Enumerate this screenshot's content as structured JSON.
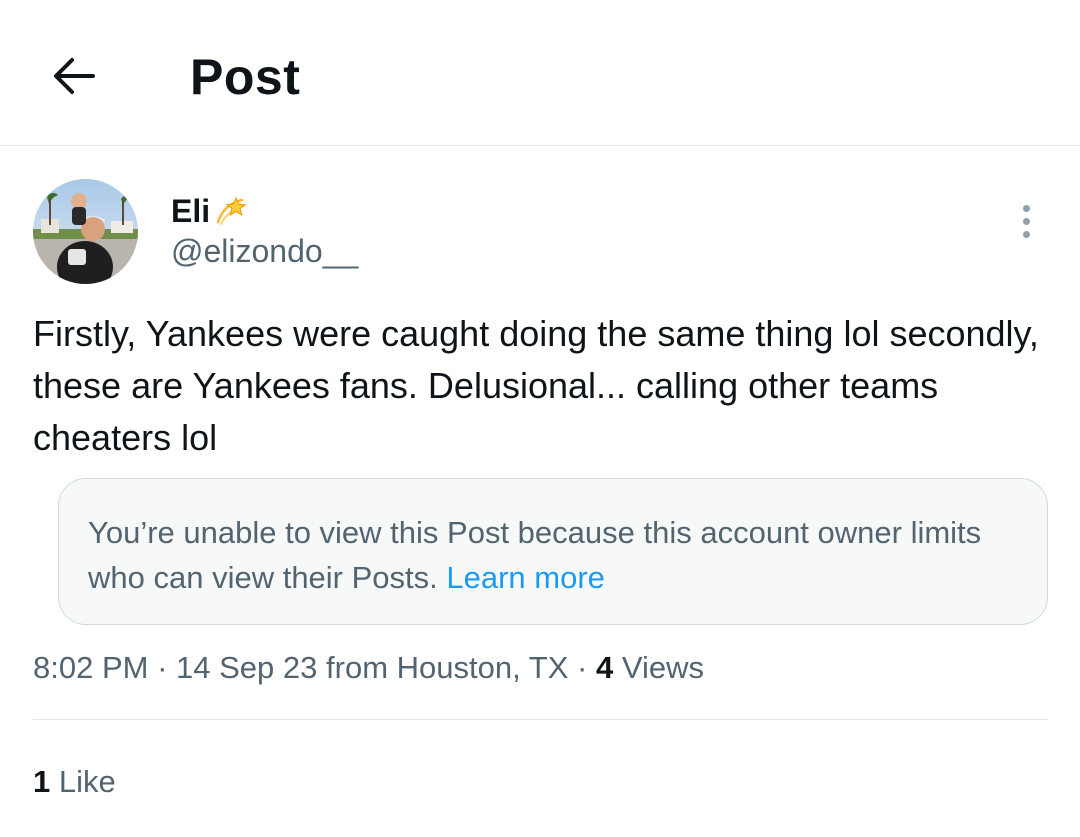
{
  "header": {
    "back_icon": "arrow-left-icon",
    "title": "Post"
  },
  "author": {
    "avatar_icon": "user-avatar-photo",
    "display_name": "Eli",
    "name_emoji": "dizzy-star-icon",
    "handle": "@elizondo__"
  },
  "post": {
    "text": "Firstly, Yankees were caught doing the same thing lol secondly, these are Yankees fans. Delusional... calling other teams cheaters lol",
    "more_icon": "more-options-icon"
  },
  "notice": {
    "text": "You’re unable to view this Post because this account owner limits who can view their Posts.",
    "link_label": "Learn more"
  },
  "meta": {
    "time": "8:02 PM",
    "date": "14 Sep 23",
    "location": "from Houston, TX",
    "views_count": "4",
    "views_label": "Views",
    "separator": "·"
  },
  "engagement": {
    "likes_count": "1",
    "likes_label": "Like"
  },
  "colors": {
    "text_primary": "#0f1419",
    "text_secondary": "#536471",
    "link": "#1d9bf0",
    "border": "#cfd9de",
    "notice_bg": "#f7f9f9"
  }
}
